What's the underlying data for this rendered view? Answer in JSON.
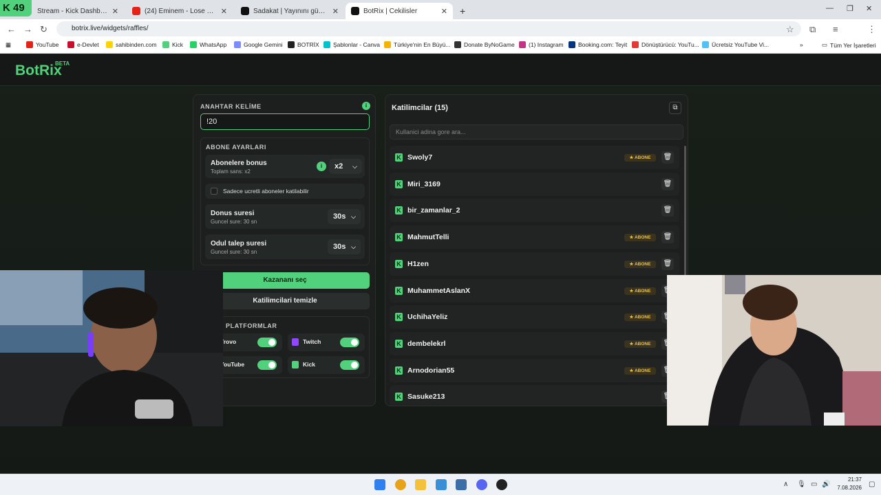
{
  "browser": {
    "tabs": [
      {
        "label": "Stream - Kick Dashboard",
        "badge": "49"
      },
      {
        "label": "(24) Eminem - Lose Yoursel"
      },
      {
        "label": "Sadakat | Yayınını güçlendirme"
      },
      {
        "label": "BotRix | Cekilisler"
      }
    ],
    "url": "botrix.live/widgets/raffles/",
    "bookmarks": [
      "YouTube",
      "e-Devlet",
      "sahibinden.com",
      "Kick",
      "WhatsApp",
      "Google Gemini",
      "BOTRİX",
      "Şablonlar - Canva",
      "Türkiye'nin En Büyü...",
      "Donate ByNoGame",
      "(1) Instagram",
      "Booking.com: Teyit",
      "Dönüştürücü: YouTu...",
      "Ücretsiz YouTube Vi..."
    ],
    "all_bookmarks": "Tüm Yer İşaretleri"
  },
  "app": {
    "logo": "BotRix",
    "beta": "BETA"
  },
  "settings": {
    "keyword_label": "ANAHTAR KELİME",
    "keyword_value": "!20",
    "sub_section": "ABONE AYARLARI",
    "sub_bonus": {
      "title": "Abonelere bonus",
      "sub": "Toplam sans: x2",
      "value": "x2"
    },
    "paid_only": "Sadece ucretli aboneler katilabilir",
    "donus": {
      "title": "Donus suresi",
      "sub": "Guncel sure: 30 sn",
      "value": "30s"
    },
    "odul": {
      "title": "Odul talep suresi",
      "sub": "Guncel sure: 30 sn",
      "value": "30s"
    },
    "pick_winner": "Kazananı seç",
    "clear": "Katilimcilari temizle",
    "platforms_label": "PLATFORMLAR",
    "platforms": [
      "Trovo",
      "Twitch",
      "YouTube",
      "Kick"
    ]
  },
  "participants": {
    "title": "Katilimcilar (15)",
    "search_placeholder": "Kullanici adina gore ara...",
    "badge_label": "ABONE",
    "items": [
      {
        "name": "Swoly7",
        "sub": true
      },
      {
        "name": "Miri_3169",
        "sub": false
      },
      {
        "name": "bir_zamanlar_2",
        "sub": false
      },
      {
        "name": "MahmutTelli",
        "sub": true
      },
      {
        "name": "H1zen",
        "sub": true
      },
      {
        "name": "MuhammetAslanX",
        "sub": true
      },
      {
        "name": "UchihaYeliz",
        "sub": true
      },
      {
        "name": "dembelekrl",
        "sub": true
      },
      {
        "name": "Arnodorian55",
        "sub": true
      },
      {
        "name": "Sasuke213",
        "sub": false
      }
    ]
  },
  "taskbar": {
    "time": "21:37",
    "date": "7.08.2026"
  },
  "colors": {
    "accent": "#52d17c",
    "badge": "#e9c04a"
  }
}
